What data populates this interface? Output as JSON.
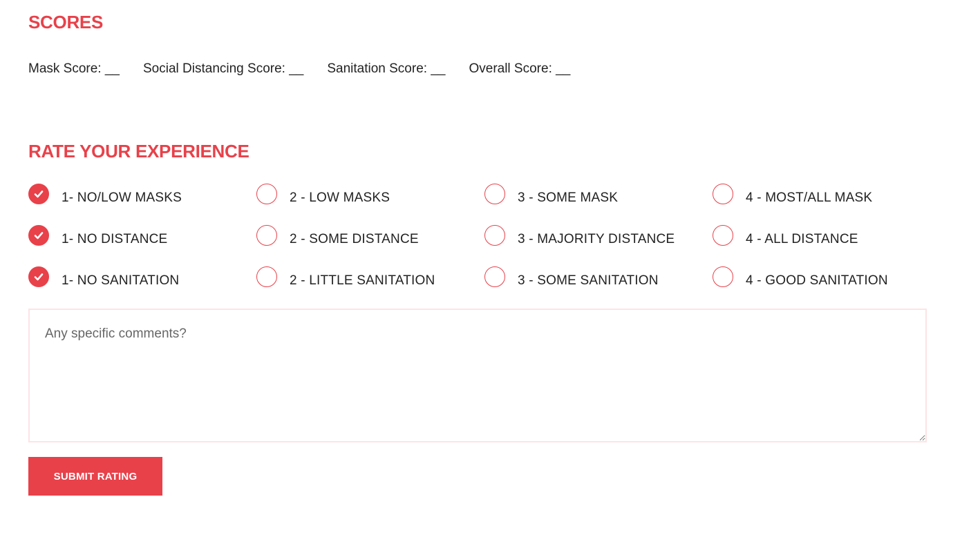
{
  "colors": {
    "accent": "#e8414a",
    "text": "#222222",
    "textarea_border": "#fde3e5"
  },
  "scores": {
    "heading": "SCORES",
    "items": [
      {
        "label": "Mask Score: __"
      },
      {
        "label": "Social Distancing Score: __"
      },
      {
        "label": "Sanitation Score: __"
      },
      {
        "label": "Overall Score: __"
      }
    ]
  },
  "rating": {
    "heading": "RATE YOUR EXPERIENCE",
    "rows": [
      {
        "category": "mask",
        "options": [
          {
            "label": "1- NO/LOW MASKS",
            "checked": true
          },
          {
            "label": "2 - LOW MASKS",
            "checked": false
          },
          {
            "label": "3 - SOME MASK",
            "checked": false
          },
          {
            "label": "4 - MOST/ALL MASK",
            "checked": false
          }
        ]
      },
      {
        "category": "distance",
        "options": [
          {
            "label": "1- NO DISTANCE",
            "checked": true
          },
          {
            "label": "2 - SOME DISTANCE",
            "checked": false
          },
          {
            "label": "3 - MAJORITY DISTANCE",
            "checked": false
          },
          {
            "label": "4 - ALL DISTANCE",
            "checked": false
          }
        ]
      },
      {
        "category": "sanitation",
        "options": [
          {
            "label": "1- NO SANITATION",
            "checked": true
          },
          {
            "label": "2 - LITTLE SANITATION",
            "checked": false
          },
          {
            "label": "3 - SOME SANITATION",
            "checked": false
          },
          {
            "label": "4 - GOOD SANITATION",
            "checked": false
          }
        ]
      }
    ]
  },
  "comments": {
    "placeholder": "Any specific comments?",
    "value": ""
  },
  "submit": {
    "label": "SUBMIT RATING"
  }
}
